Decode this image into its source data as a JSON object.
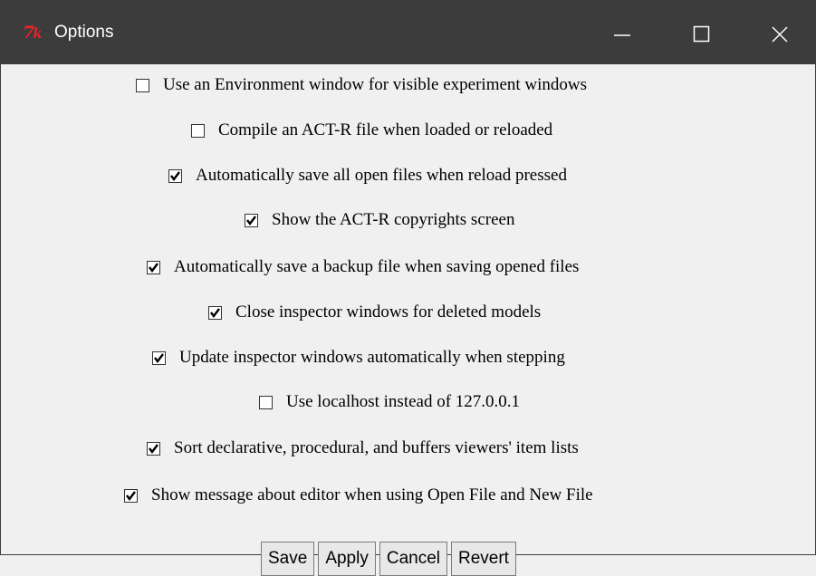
{
  "window": {
    "title": "Options",
    "app_icon": "tk-feather-icon",
    "controls": [
      "minimize-icon",
      "maximize-icon",
      "close-icon"
    ]
  },
  "options": [
    {
      "label": "Use an Environment window for visible experiment windows",
      "checked": false
    },
    {
      "label": "Compile an ACT-R file when loaded or reloaded",
      "checked": false
    },
    {
      "label": "Automatically save all open files when reload pressed",
      "checked": true
    },
    {
      "label": "Show the ACT-R copyrights screen",
      "checked": true
    },
    {
      "label": "Automatically save a backup file when saving opened files",
      "checked": true
    },
    {
      "label": "Close inspector windows for deleted models",
      "checked": true
    },
    {
      "label": "Update inspector windows automatically when stepping",
      "checked": true
    },
    {
      "label": "Use localhost instead of 127.0.0.1",
      "checked": false
    },
    {
      "label": "Sort declarative, procedural, and buffers viewers' item lists",
      "checked": true
    },
    {
      "label": "Show message about editor when using Open File and New File",
      "checked": true
    }
  ],
  "buttons": {
    "save": "Save",
    "apply": "Apply",
    "cancel": "Cancel",
    "revert": "Revert"
  },
  "colors": {
    "titlebar": "#3c3c3c",
    "background": "#f0f0f0",
    "app_icon": "#e8232a"
  }
}
